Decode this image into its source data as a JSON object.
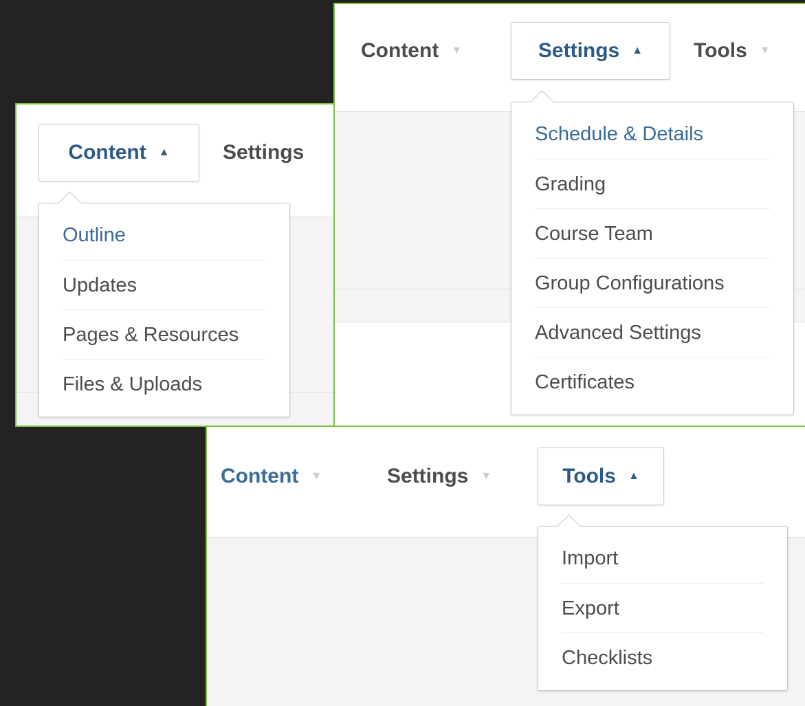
{
  "panels": {
    "content": {
      "nav": {
        "content": "Content",
        "settings": "Settings"
      },
      "menu": [
        "Outline",
        "Updates",
        "Pages & Resources",
        "Files & Uploads"
      ]
    },
    "settings": {
      "nav": {
        "content": "Content",
        "settings": "Settings",
        "tools": "Tools"
      },
      "menu": [
        "Schedule & Details",
        "Grading",
        "Course Team",
        "Group Configurations",
        "Advanced Settings",
        "Certificates"
      ]
    },
    "tools": {
      "nav": {
        "content": "Content",
        "settings": "Settings",
        "tools": "Tools"
      },
      "menu": [
        "Import",
        "Export",
        "Checklists"
      ]
    }
  },
  "icons": {
    "caret_open": "caret-up-icon",
    "caret_closed": "caret-down-icon"
  },
  "colors": {
    "panel_border": "#7bc043",
    "nav_active": "#2d5b89",
    "nav_link": "#3a6b99",
    "text": "#4d4d4d",
    "background": "#232323"
  }
}
